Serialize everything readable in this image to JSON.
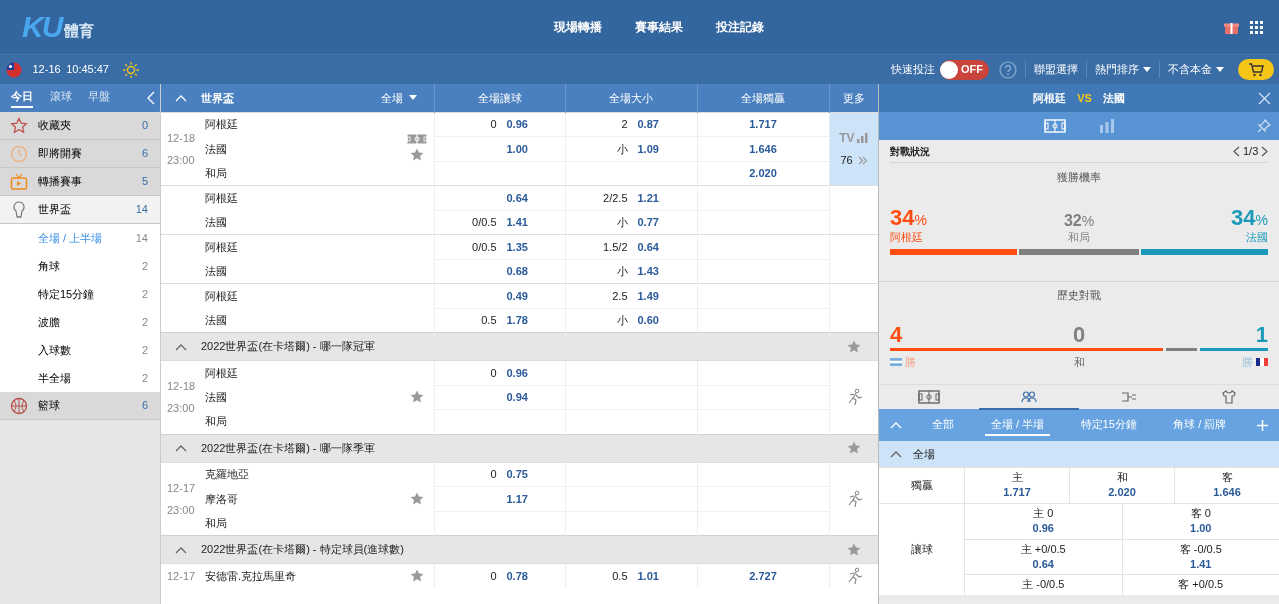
{
  "header": {
    "logo": "KU",
    "logo_sub": "體育",
    "nav": [
      "現場轉播",
      "賽事結果",
      "投注記錄"
    ]
  },
  "toolbar": {
    "date": "12-16",
    "time": "10:45:47",
    "quick_bet_label": "快速投注",
    "quick_bet": {
      "on": false,
      "label": "OFF"
    },
    "menus": [
      {
        "label": "聯盟選擇",
        "dropdown": false
      },
      {
        "label": "熱門排序",
        "dropdown": true
      },
      {
        "label": "不含本金",
        "dropdown": true
      }
    ]
  },
  "sidebar": {
    "tabs": [
      {
        "label": "今日",
        "selected": true
      },
      {
        "label": "滾球",
        "selected": false
      },
      {
        "label": "早盤",
        "selected": false
      }
    ],
    "items": [
      {
        "kind": "favorites",
        "label": "收藏夾",
        "count": "0",
        "expanded": false
      },
      {
        "kind": "upcoming",
        "label": "即將開賽",
        "count": "6",
        "expanded": false
      },
      {
        "kind": "broadcast",
        "label": "轉播賽事",
        "count": "5",
        "expanded": false
      },
      {
        "kind": "trophy",
        "label": "世界盃",
        "count": "14",
        "expanded": true,
        "children": [
          {
            "label": "全場 / 上半場",
            "count": "14",
            "selected": true
          },
          {
            "label": "角球",
            "count": "2",
            "selected": false
          },
          {
            "label": "特定15分鐘",
            "count": "2",
            "selected": false
          },
          {
            "label": "波膽",
            "count": "2",
            "selected": false
          },
          {
            "label": "入球數",
            "count": "2",
            "selected": false
          },
          {
            "label": "半全場",
            "count": "2",
            "selected": false
          }
        ]
      },
      {
        "kind": "basketball",
        "label": "籃球",
        "count": "6",
        "expanded": false
      }
    ]
  },
  "board": {
    "league": "世界盃",
    "period": "全場",
    "columns": [
      "全場讓球",
      "全場大小",
      "全場獨贏",
      "更多"
    ],
    "groups": [
      {
        "date": "12-18",
        "time": "23:00",
        "pitch_view": true,
        "favorite": false,
        "more": {
          "kind": "tv",
          "label": "TV",
          "count": "76"
        },
        "blocks": [
          {
            "rows": [
              {
                "team": "阿根廷",
                "handicap": "0",
                "handicap_odds": "0.96",
                "total": "2",
                "total_odds": "0.87",
                "win_odds": "1.717"
              },
              {
                "team": "法國",
                "handicap_odds": "1.00",
                "total": "小",
                "total_odds": "1.09",
                "win_odds": "1.646"
              },
              {
                "team": "和局",
                "win_odds": "2.020"
              }
            ]
          },
          {
            "rows": [
              {
                "team": "阿根廷",
                "handicap_odds": "0.64",
                "total": "2/2.5",
                "total_odds": "1.21"
              },
              {
                "team": "法國",
                "handicap": "0/0.5",
                "handicap_odds": "1.41",
                "total": "小",
                "total_odds": "0.77"
              }
            ]
          },
          {
            "rows": [
              {
                "team": "阿根廷",
                "handicap": "0/0.5",
                "handicap_odds": "1.35",
                "total": "1.5/2",
                "total_odds": "0.64"
              },
              {
                "team": "法國",
                "handicap_odds": "0.68",
                "total": "小",
                "total_odds": "1.43"
              }
            ]
          },
          {
            "rows": [
              {
                "team": "阿根廷",
                "handicap_odds": "0.49",
                "total": "2.5",
                "total_odds": "1.49"
              },
              {
                "team": "法國",
                "handicap": "0.5",
                "handicap_odds": "1.78",
                "total": "小",
                "total_odds": "0.60"
              }
            ]
          }
        ]
      },
      {
        "title": "2022世界盃(在卡塔爾) - 哪一隊冠軍",
        "date": "12-18",
        "time": "23:00",
        "pitch_view": false,
        "favorite": false,
        "more": {
          "kind": "runner"
        },
        "blocks": [
          {
            "rows": [
              {
                "team": "阿根廷",
                "handicap": "0",
                "handicap_odds": "0.96"
              },
              {
                "team": "法國",
                "handicap_odds": "0.94"
              },
              {
                "team": "和局"
              }
            ]
          }
        ]
      },
      {
        "title": "2022世界盃(在卡塔爾) - 哪一隊季軍",
        "date": "12-17",
        "time": "23:00",
        "pitch_view": false,
        "favorite": false,
        "more": {
          "kind": "runner"
        },
        "blocks": [
          {
            "rows": [
              {
                "team": "克羅地亞",
                "handicap": "0",
                "handicap_odds": "0.75"
              },
              {
                "team": "摩洛哥",
                "handicap_odds": "1.17"
              },
              {
                "team": "和局"
              }
            ]
          }
        ]
      },
      {
        "title": "2022世界盃(在卡塔爾) - 特定球員(進球數)",
        "date": "12-17",
        "pitch_view": false,
        "favorite": false,
        "more": {
          "kind": "runner"
        },
        "blocks": [
          {
            "rows": [
              {
                "team": "安德雷.克拉馬里奇",
                "handicap": "0",
                "handicap_odds": "0.78",
                "total": "0.5",
                "total_odds": "1.01",
                "win_odds": "2.727"
              }
            ]
          }
        ]
      }
    ]
  },
  "detail": {
    "home": "阿根廷",
    "vs": "VS",
    "away": "法國",
    "view_tabs": [
      {
        "kind": "pitch",
        "selected": true
      },
      {
        "kind": "chart",
        "selected": false
      }
    ],
    "section_title": "對戰狀況",
    "pager": "1/3",
    "win_prob": {
      "title": "獲勝機率",
      "outcomes": [
        {
          "kind": "home",
          "value": "34",
          "unit": "%",
          "label": "阿根廷"
        },
        {
          "kind": "draw",
          "value": "32",
          "unit": "%",
          "label": "和局"
        },
        {
          "kind": "away",
          "value": "34",
          "unit": "%",
          "label": "法國"
        }
      ]
    },
    "history": {
      "title": "歷史對戰",
      "outcomes": [
        {
          "kind": "home",
          "value": "4",
          "label": "勝"
        },
        {
          "kind": "draw",
          "value": "0",
          "label": "和"
        },
        {
          "kind": "away",
          "value": "1",
          "label": "勝"
        }
      ]
    },
    "icon_tabs": [
      {
        "kind": "pitch",
        "selected": false
      },
      {
        "kind": "players",
        "selected": true
      },
      {
        "kind": "bracket",
        "selected": false
      },
      {
        "kind": "shirt",
        "selected": false
      }
    ],
    "market_tabs": [
      {
        "label": "全部",
        "selected": false
      },
      {
        "label": "全場 / 半場",
        "selected": true
      },
      {
        "label": "特定15分鐘",
        "selected": false
      },
      {
        "label": "角球 / 罰牌",
        "selected": false
      }
    ],
    "section": "全場",
    "markets": [
      {
        "label": "獨贏",
        "rows": [
          [
            {
              "label": "主",
              "odds": "1.717"
            },
            {
              "label": "和",
              "odds": "2.020"
            },
            {
              "label": "客",
              "odds": "1.646"
            }
          ]
        ]
      },
      {
        "label": "讓球",
        "rows": [
          [
            {
              "label": "主 0",
              "odds": "0.96"
            },
            {
              "label": "客 0",
              "odds": "1.00"
            }
          ],
          [
            {
              "label": "主 +0/0.5",
              "odds": "0.64"
            },
            {
              "label": "客 -0/0.5",
              "odds": "1.41"
            }
          ],
          [
            {
              "label": "主 -0/0.5"
            },
            {
              "label": "客 +0/0.5"
            }
          ]
        ]
      }
    ]
  }
}
